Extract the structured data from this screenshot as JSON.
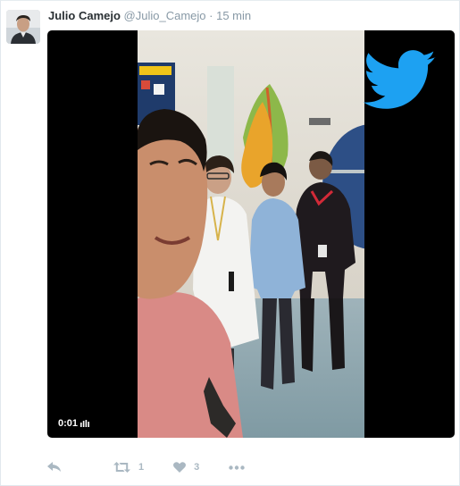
{
  "tweet": {
    "author_name": "Julio Camejo",
    "handle": "@Julio_Camejo",
    "separator": "·",
    "time": "15 min"
  },
  "media": {
    "duration": "0:01",
    "type_icon": "video-indicator-icon",
    "overlay_logo": "twitter-bird-icon",
    "logo_color": "#1da1f2"
  },
  "actions": {
    "reply_icon": "reply-icon",
    "retweet_icon": "retweet-icon",
    "retweet_count": "1",
    "like_icon": "heart-icon",
    "like_count": "3",
    "more_icon": "more-icon"
  },
  "colors": {
    "name": "#292f33",
    "meta": "#8899a6",
    "action": "#aab8c2",
    "border": "#e1e8ed"
  }
}
